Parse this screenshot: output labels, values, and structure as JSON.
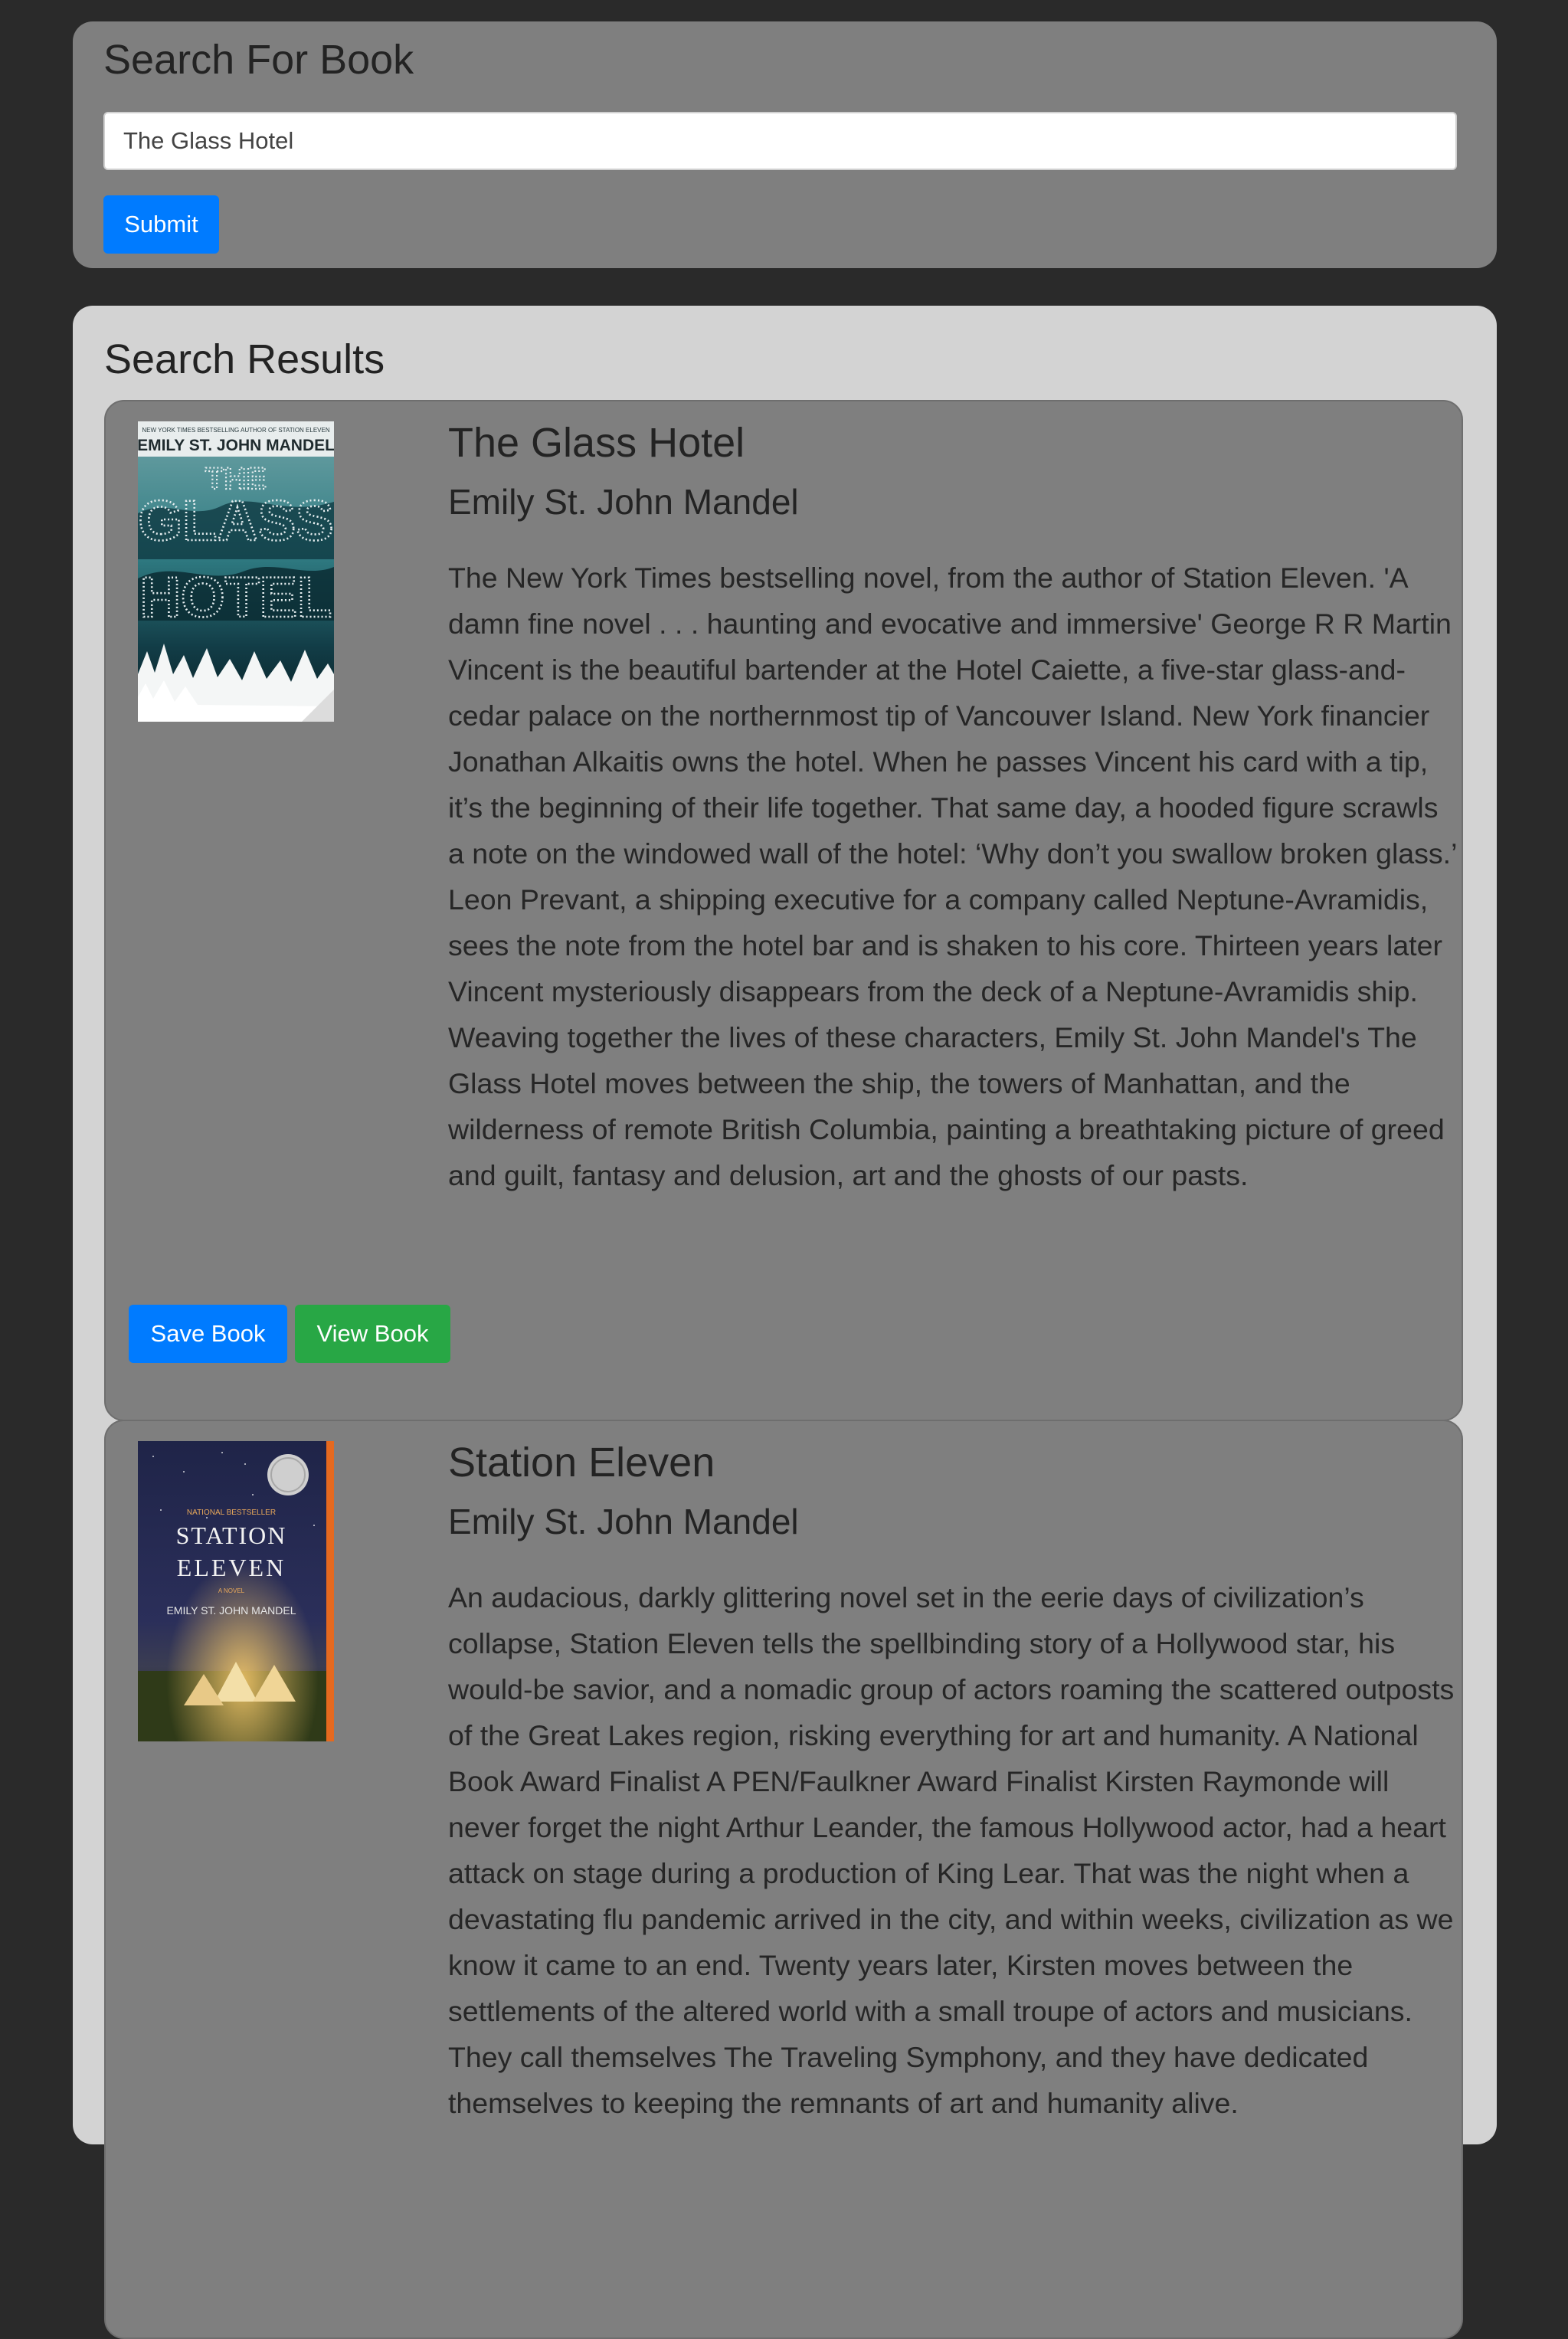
{
  "search": {
    "title": "Search For Book",
    "query": "The Glass Hotel",
    "submit_label": "Submit"
  },
  "results": {
    "title": "Search Results",
    "books": [
      {
        "title": "The Glass Hotel",
        "author": "Emily St. John Mandel",
        "description": "The New York Times bestselling novel, from the author of Station Eleven. 'A damn fine novel . . . haunting and evocative and immersive' George R R Martin Vincent is the beautiful bartender at the Hotel Caiette, a five-star glass-and-cedar palace on the northernmost tip of Vancouver Island. New York financier Jonathan Alkaitis owns the hotel. When he passes Vincent his card with a tip, it’s the beginning of their life together. That same day, a hooded figure scrawls a note on the windowed wall of the hotel: ‘Why don’t you swallow broken glass.’ Leon Prevant, a shipping executive for a company called Neptune-Avramidis, sees the note from the hotel bar and is shaken to his core. Thirteen years later Vincent mysteriously disappears from the deck of a Neptune-Avramidis ship. Weaving together the lives of these characters, Emily St. John Mandel's The Glass Hotel moves between the ship, the towers of Manhattan, and the wilderness of remote British Columbia, painting a breathtaking picture of greed and guilt, fantasy and delusion, art and the ghosts of our pasts.",
        "save_label": "Save Book",
        "view_label": "View Book",
        "cover": {
          "top_line": "NEW YORK TIMES BESTSELLING AUTHOR OF STATION ELEVEN",
          "author": "EMILY ST. JOHN MANDEL",
          "word1": "THE",
          "word2": "GLASS",
          "word3": "HOTEL"
        }
      },
      {
        "title": "Station Eleven",
        "author": "Emily St. John Mandel",
        "description": "An audacious, darkly glittering novel set in the eerie days of civilization’s collapse, Station Eleven tells the spellbinding story of a Hollywood star, his would-be savior, and a nomadic group of actors roaming the scattered outposts of the Great Lakes region, risking everything for art and humanity. A National Book Award Finalist A PEN/Faulkner Award Finalist Kirsten Raymonde will never forget the night Arthur Leander, the famous Hollywood actor, had a heart attack on stage during a production of King Lear. That was the night when a devastating flu pandemic arrived in the city, and within weeks, civilization as we know it came to an end. Twenty years later, Kirsten moves between the settlements of the altered world with a small troupe of actors and musicians. They call themselves The Traveling Symphony, and they have dedicated themselves to keeping the remnants of art and humanity alive.",
        "cover": {
          "badge": "NATIONAL BESTSELLER",
          "word1": "STATION",
          "word2": "ELEVEN",
          "subtitle": "A NOVEL",
          "author": "EMILY ST. JOHN MANDEL"
        }
      }
    ]
  }
}
